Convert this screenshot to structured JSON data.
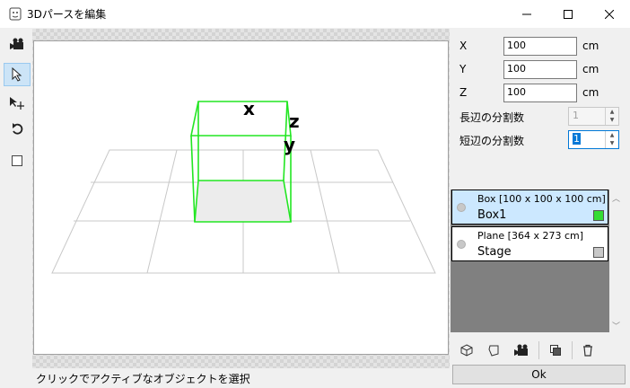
{
  "window": {
    "title": "3Dパースを編集",
    "minimize_icon": "minimize-icon",
    "maximize_icon": "maximize-icon",
    "close_icon": "close-icon"
  },
  "left_toolbar": {
    "items": [
      {
        "icon": "camera-icon",
        "active": false
      },
      {
        "icon": "cursor-icon",
        "active": true
      },
      {
        "icon": "move-icon",
        "active": false
      },
      {
        "icon": "rotate-icon",
        "active": false
      },
      {
        "icon": "square-icon",
        "active": false
      }
    ]
  },
  "viewport": {
    "axis_labels": {
      "x": "x",
      "z": "z",
      "y": "y"
    },
    "box_color": "#22e622"
  },
  "fields": {
    "x_label": "X",
    "x_value": "100",
    "x_unit": "cm",
    "y_label": "Y",
    "y_value": "100",
    "y_unit": "cm",
    "z_label": "Z",
    "z_value": "100",
    "z_unit": "cm",
    "long_div_label": "長辺の分割数",
    "long_div_value": "1",
    "short_div_label": "短辺の分割数",
    "short_div_value": "1"
  },
  "objects": [
    {
      "desc": "Box [100 x 100 x 100 cm]",
      "name": "Box1",
      "color": "#33dd33",
      "selected": true
    },
    {
      "desc": "Plane [364 x 273 cm]",
      "name": "Stage",
      "color": "#c8c8c8",
      "selected": false
    }
  ],
  "bottom_toolbar": [
    "cube-icon",
    "plane-icon",
    "camera-icon",
    "duplicate-icon",
    "trash-icon"
  ],
  "status": "クリックでアクティブなオブジェクトを選択",
  "ok_label": "Ok"
}
